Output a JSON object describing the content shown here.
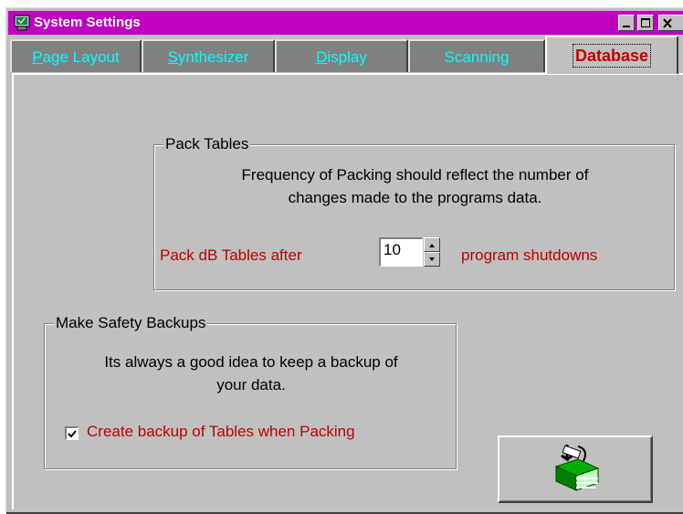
{
  "window": {
    "title": "System Settings"
  },
  "tabs": [
    {
      "prefix": "",
      "underline": "P",
      "rest": "age Layout",
      "active": false
    },
    {
      "prefix": "",
      "underline": "S",
      "rest": "ynthesizer",
      "active": false
    },
    {
      "prefix": "",
      "underline": "D",
      "rest": "isplay",
      "active": false
    },
    {
      "prefix": "Scanning",
      "underline": "",
      "rest": "",
      "active": false
    },
    {
      "prefix": "Database",
      "underline": "",
      "rest": "",
      "active": true
    }
  ],
  "pack": {
    "legend": "Pack Tables",
    "line1": "Frequency of Packing should reflect the number of",
    "line2": "changes made to the programs data.",
    "label_before": "Pack dB Tables after",
    "value": "10",
    "label_after": "program shutdowns"
  },
  "backup": {
    "legend": "Make Safety Backups",
    "line1": "Its always a good idea to keep a backup of",
    "line2": "your data.",
    "checkbox_label": "Create backup of Tables when Packing",
    "checked": true
  },
  "colors": {
    "title_bar": "#c000c0",
    "tab_text": "#00ffff",
    "active_tab_text": "#c00000",
    "label_red": "#c00000"
  },
  "icons": {
    "app": "computer-icon",
    "action_button": "database-pack-icon"
  }
}
